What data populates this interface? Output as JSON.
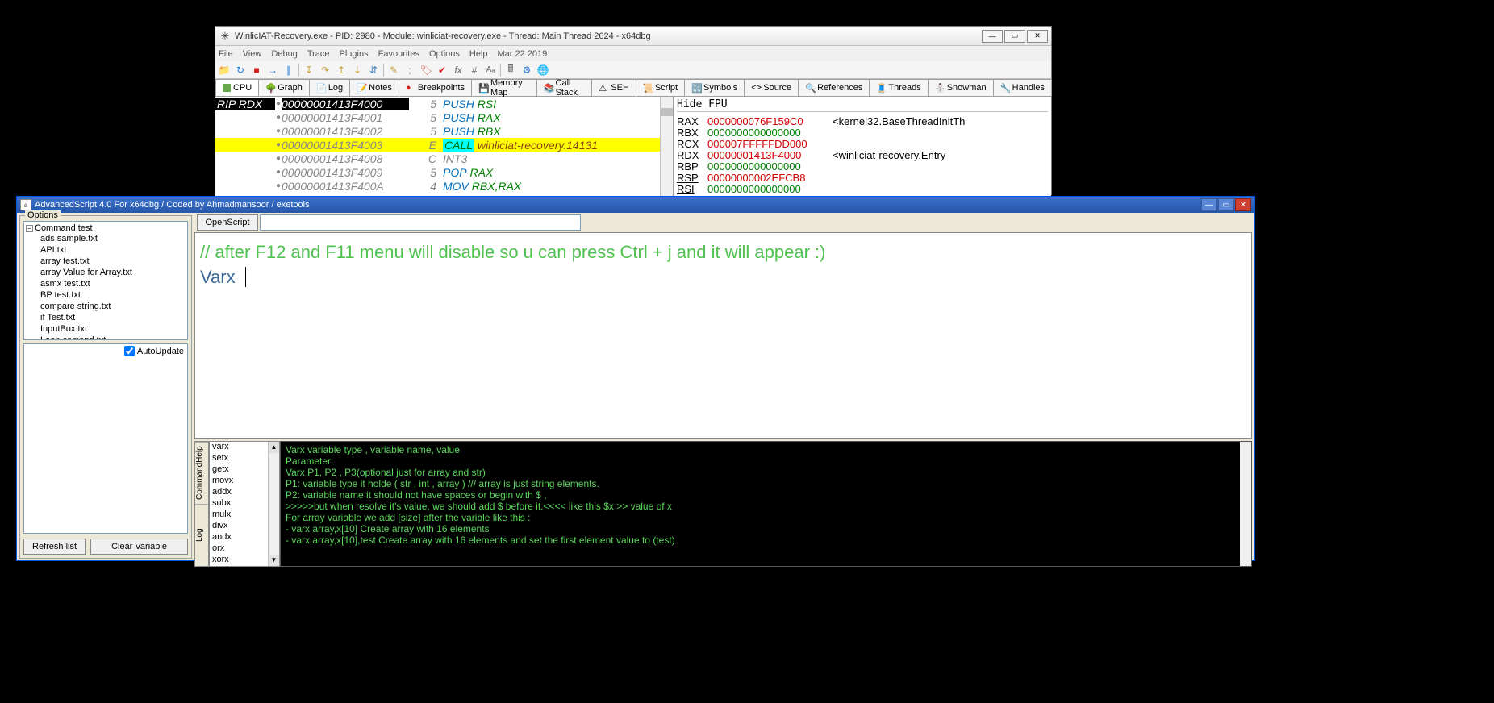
{
  "dbg": {
    "title": "WinlicIAT-Recovery.exe - PID: 2980 - Module: winliciat-recovery.exe - Thread: Main Thread 2624 - x64dbg",
    "menu": [
      "File",
      "View",
      "Debug",
      "Trace",
      "Plugins",
      "Favourites",
      "Options",
      "Help",
      "Mar 22 2019"
    ],
    "tabs": [
      {
        "label": "CPU",
        "active": true
      },
      {
        "label": "Graph"
      },
      {
        "label": "Log"
      },
      {
        "label": "Notes"
      },
      {
        "label": "Breakpoints"
      },
      {
        "label": "Memory Map"
      },
      {
        "label": "Call Stack"
      },
      {
        "label": "SEH"
      },
      {
        "label": "Script"
      },
      {
        "label": "Symbols"
      },
      {
        "label": "Source"
      },
      {
        "label": "References"
      },
      {
        "label": "Threads"
      },
      {
        "label": "Snowman"
      },
      {
        "label": "Handles"
      }
    ],
    "disasm": [
      {
        "reg": "RIP RDX",
        "reghl": true,
        "addr": "00000001413F4000",
        "addrhl": true,
        "col": "5",
        "mn": "PUSH",
        "op": "RSI"
      },
      {
        "addr": "00000001413F4001",
        "col": "5",
        "mn": "PUSH",
        "op": "RAX"
      },
      {
        "addr": "00000001413F4002",
        "col": "5",
        "mn": "PUSH",
        "op": "RBX"
      },
      {
        "addr": "00000001413F4003",
        "col": "E",
        "mn": "CALL",
        "op": "winliciat-recovery.14131",
        "call": true,
        "hlrow": true
      },
      {
        "addr": "00000001413F4008",
        "col": "C",
        "mn": "INT3"
      },
      {
        "addr": "00000001413F4009",
        "col": "5",
        "mn": "POP",
        "op": "RAX"
      },
      {
        "addr": "00000001413F400A",
        "col": "4",
        "mn": "MOV",
        "op": "RBX,RAX"
      }
    ],
    "hidefpu": "Hide FPU",
    "regs": [
      {
        "n": "RAX",
        "v": "0000000076F159C0",
        "red": true,
        "c": "<kernel32.BaseThreadInitTh"
      },
      {
        "n": "RBX",
        "v": "0000000000000000"
      },
      {
        "n": "RCX",
        "v": "000007FFFFFDD000",
        "red": true
      },
      {
        "n": "RDX",
        "v": "00000001413F4000",
        "red": true,
        "c": "<winliciat-recovery.Entry"
      },
      {
        "n": "RBP",
        "v": "0000000000000000"
      },
      {
        "n": "RSP",
        "v": "00000000002EFCB8",
        "red": true,
        "u": true
      },
      {
        "n": "RSI",
        "v": "0000000000000000",
        "u": true
      }
    ]
  },
  "as": {
    "title": "AdvancedScript 4.0 For x64dbg / Coded by Ahmadmansoor / exetools",
    "options_label": "Options",
    "tree_root": "Command test",
    "tree_items": [
      "ads sample.txt",
      "API.txt",
      "array test.txt",
      "array Value for Array.txt",
      "asmx test.txt",
      "BP test.txt",
      "compare string.txt",
      "if Test.txt",
      "InputBox.txt",
      "Loop comand.txt"
    ],
    "autoupdate": "AutoUpdate",
    "refresh_btn": "Refresh list",
    "clear_btn": "Clear Variable",
    "openscript": "OpenScript",
    "editor": {
      "comment": "// after F12 and F11 menu will disable so u can press Ctrl + j and it will appear :)",
      "line2": "Varx "
    },
    "side_tabs": [
      "CommandHelp",
      "Log"
    ],
    "cmd_list": [
      "varx",
      "setx",
      "getx",
      "movx",
      "addx",
      "subx",
      "mulx",
      "divx",
      "andx",
      "orx",
      "xorx"
    ],
    "help": [
      "Varx      variable type ,   variable name, value",
      "Parameter:",
      "Varx P1, P2 , P3(optional just for array and str)",
      "        P1: variable type it holde ( str , int , array )   /// array is just string elements.",
      "        P2: variable name it should not have spaces or begin with $ ,",
      "        >>>>>but when resolve it's value, we should add $ before it.<<<< like this $x  >> value of x",
      "                For array variable we add [size] after the varible like this :",
      "                  - varx array,x[10]                       Create array with 16 elements",
      "                  - varx array,x[10],test                  Create array with 16 elements and set the first element value to (test)"
    ]
  }
}
